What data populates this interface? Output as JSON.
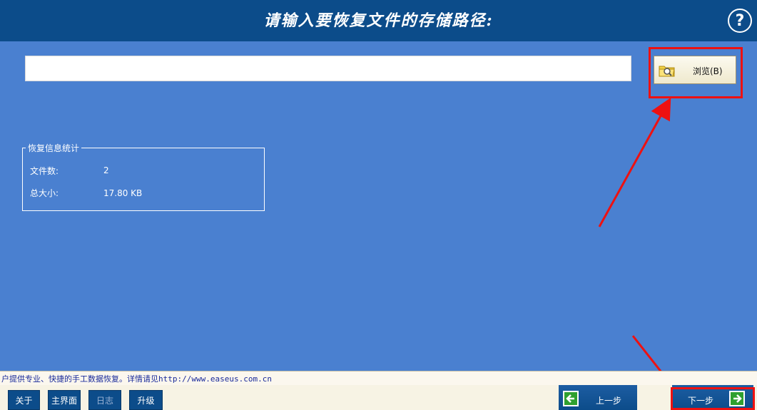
{
  "header": {
    "title": "请输入要恢复文件的存储路径:",
    "help_label": "?"
  },
  "path": {
    "value": "",
    "placeholder": ""
  },
  "browse_button": {
    "label": "浏览(B)",
    "icon": "folder-search-icon"
  },
  "stats": {
    "group_title": "恢复信息统计",
    "file_count_label": "文件数:",
    "file_count_value": "2",
    "total_size_label": "总大小:",
    "total_size_value": "17.80 KB"
  },
  "status_bar": {
    "text": "户提供专业、快捷的手工数据恢复。详情请见http://www.easeus.com.cn"
  },
  "bottom_nav": {
    "about": "关于",
    "home": "主界面",
    "log": "日志",
    "upgrade": "升级"
  },
  "wizard": {
    "back": "上一步",
    "next": "下一步"
  },
  "colors": {
    "background": "#4a80d0",
    "header": "#0c4c8a",
    "highlight": "#ee1111",
    "wizard_arrow": "#2fa02f"
  }
}
